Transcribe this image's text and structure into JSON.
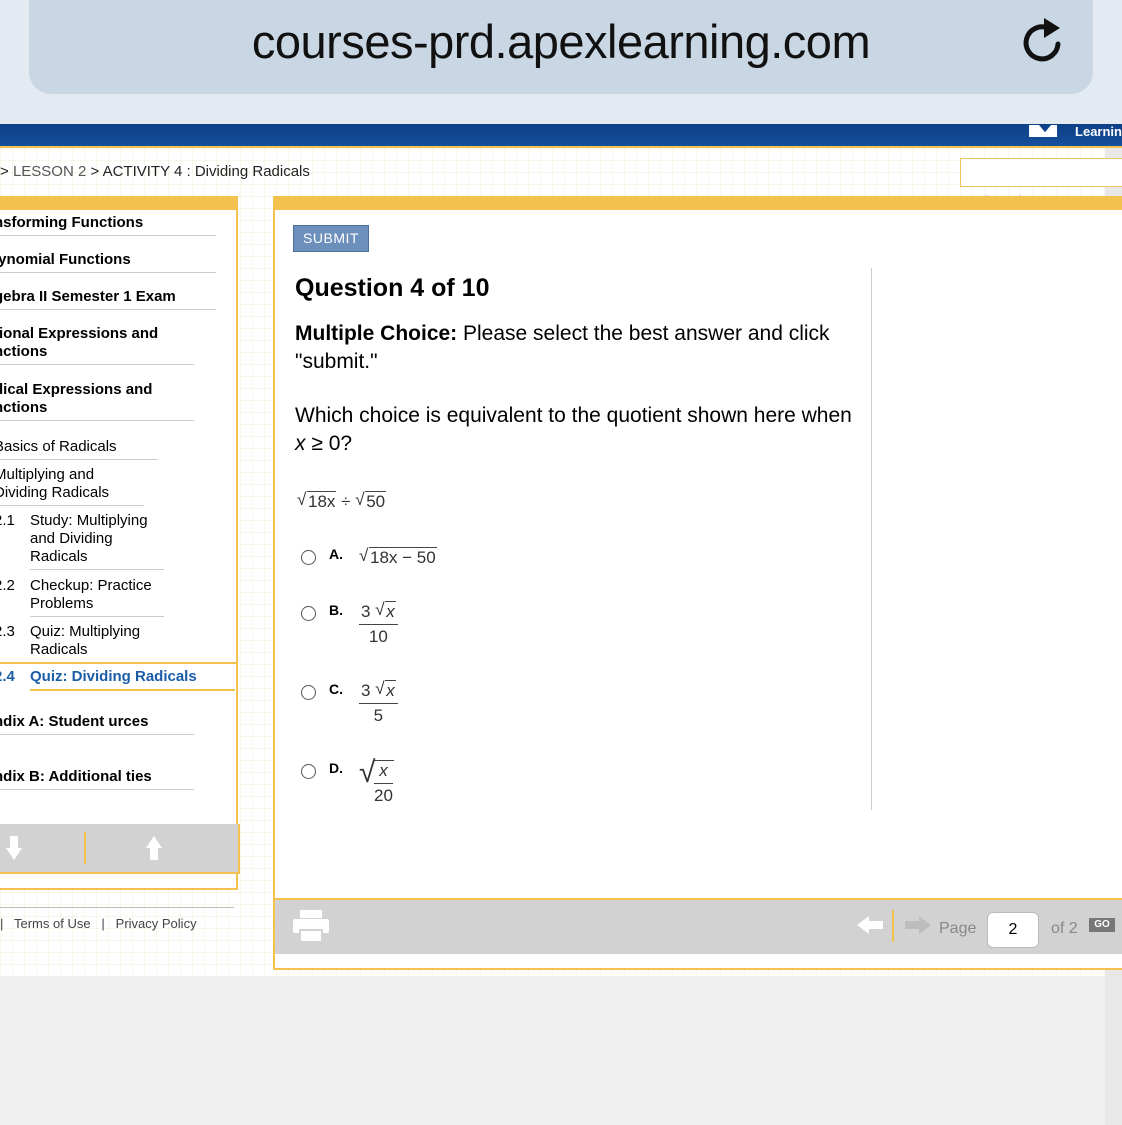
{
  "browser": {
    "url": "courses-prd.apexlearning.com"
  },
  "header": {
    "logo_text": "Learnin"
  },
  "breadcrumb": {
    "prefix": "> ",
    "lesson": "LESSON 2",
    "sep": " > ",
    "activity": "ACTIVITY 4 : Dividing Radicals"
  },
  "search": {
    "placeholder": "",
    "label": "Search"
  },
  "sidebar": {
    "units": [
      "nsforming Functions",
      "lynomial Functions",
      "gebra II Semester 1 Exam",
      "tional Expressions and nctions",
      "dical Expressions and nctions"
    ],
    "lessons": [
      "Basics of Radicals",
      "Multiplying and Dividing Radicals"
    ],
    "activities": [
      {
        "num": "2.1",
        "label": "Study: Multiplying and Dividing Radicals"
      },
      {
        "num": "2.2",
        "label": "Checkup: Practice Problems"
      },
      {
        "num": "2.3",
        "label": "Quiz: Multiplying Radicals"
      },
      {
        "num": "2.4",
        "label": "Quiz: Dividing Radicals"
      }
    ],
    "appendices": [
      "ndix A: Student urces",
      "ndix B: Additional ties"
    ]
  },
  "footer": {
    "terms": "Terms of Use",
    "privacy": "Privacy Policy",
    "sep": "|"
  },
  "question": {
    "submit_label": "SUBMIT",
    "title": "Question 4 of 10",
    "type_label": "Multiple Choice:",
    "instructions": " Please select the best answer and click \"submit.\"",
    "prompt_a": "Which choice is equivalent to the quotient shown here when ",
    "prompt_var": "x",
    "prompt_b": " ≥ 0?",
    "expression": {
      "left": "18x",
      "op": " ÷ ",
      "right": "50"
    },
    "choices": [
      {
        "letter": "A.",
        "math": "18x − 50"
      },
      {
        "letter": "B.",
        "num_coef": "3",
        "num_rad": "x",
        "den": "10"
      },
      {
        "letter": "C.",
        "num_coef": "3",
        "num_rad": "x",
        "den": "5"
      },
      {
        "letter": "D.",
        "num": "x",
        "den": "20"
      }
    ]
  },
  "pager": {
    "page_label": "Page",
    "current": "2",
    "of_label": "of 2",
    "go_label": "GO"
  },
  "colors": {
    "accent": "#f2c14e",
    "header_blue": "#154f9d",
    "submit": "#6d8fbc",
    "active_link": "#1b5ea8"
  }
}
